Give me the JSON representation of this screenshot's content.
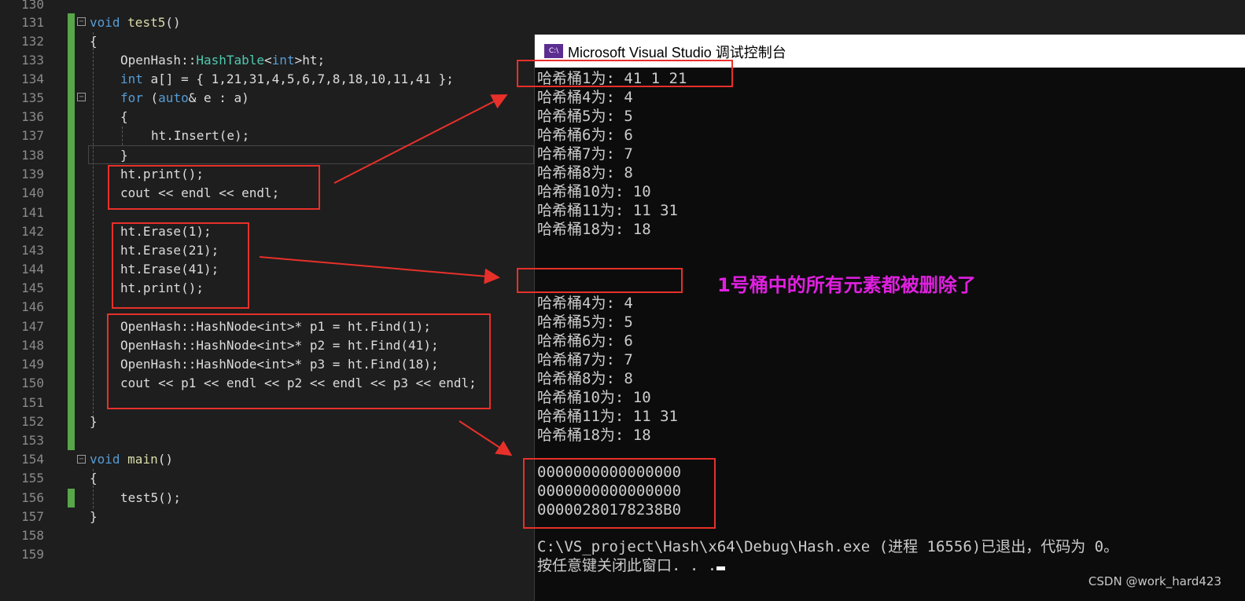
{
  "editor": {
    "line_numbers": [
      "130",
      "131",
      "132",
      "133",
      "134",
      "135",
      "136",
      "137",
      "138",
      "139",
      "140",
      "141",
      "142",
      "143",
      "144",
      "145",
      "146",
      "147",
      "148",
      "149",
      "150",
      "151",
      "152",
      "153",
      "154",
      "155",
      "156",
      "157",
      "158",
      "159"
    ],
    "code": {
      "l131_kw": "void",
      "l131_fn": "test5",
      "l131_rest": "()",
      "l132": "{",
      "l133_a": "OpenHash::",
      "l133_ty": "HashTable",
      "l133_b": "<",
      "l133_kw": "int",
      "l133_c": ">ht;",
      "l134_kw": "int",
      "l134_rest": " a[] = { 1,21,31,4,5,6,7,8,18,10,11,41 };",
      "l135_kw": "for",
      "l135_a": " (",
      "l135_kw2": "auto",
      "l135_b": "& e : a)",
      "l136": "{",
      "l137": "ht.Insert(e);",
      "l138": "}",
      "l139": "ht.print();",
      "l140": "cout << endl << endl;",
      "l142": "ht.Erase(1);",
      "l143": "ht.Erase(21);",
      "l144": "ht.Erase(41);",
      "l145": "ht.print();",
      "l147": "OpenHash::HashNode<int>* p1 = ht.Find(1);",
      "l148": "OpenHash::HashNode<int>* p2 = ht.Find(41);",
      "l149": "OpenHash::HashNode<int>* p3 = ht.Find(18);",
      "l150": "cout << p1 << endl << p2 << endl << p3 << endl;",
      "l152": "}",
      "l154_kw": "void",
      "l154_fn": "main",
      "l154_rest": "()",
      "l155": "{",
      "l156": "test5();",
      "l157": "}"
    }
  },
  "console": {
    "title": "Microsoft Visual Studio 调试控制台",
    "icon_label": "C:\\",
    "first_print": [
      "哈希桶1为: 41 1 21",
      "哈希桶4为: 4",
      "哈希桶5为: 5",
      "哈希桶6为: 6",
      "哈希桶7为: 7",
      "哈希桶8为: 8",
      "哈希桶10为: 10",
      "哈希桶11为: 11 31",
      "哈希桶18为: 18"
    ],
    "second_print": [
      "哈希桶4为: 4",
      "哈希桶5为: 5",
      "哈希桶6为: 6",
      "哈希桶7为: 7",
      "哈希桶8为: 8",
      "哈希桶10为: 10",
      "哈希桶11为: 11 31",
      "哈希桶18为: 18"
    ],
    "find_results": [
      "0000000000000000",
      "0000000000000000",
      "00000280178238B0"
    ],
    "exit_line": "C:\\VS_project\\Hash\\x64\\Debug\\Hash.exe (进程 16556)已退出，代码为 0。",
    "close_prompt": "按任意键关闭此窗口. . ."
  },
  "annotation": {
    "note": "1号桶中的所有元素都被删除了",
    "color": "#e8302a",
    "note_color": "#e020e0"
  },
  "watermark": "CSDN @work_hard423"
}
